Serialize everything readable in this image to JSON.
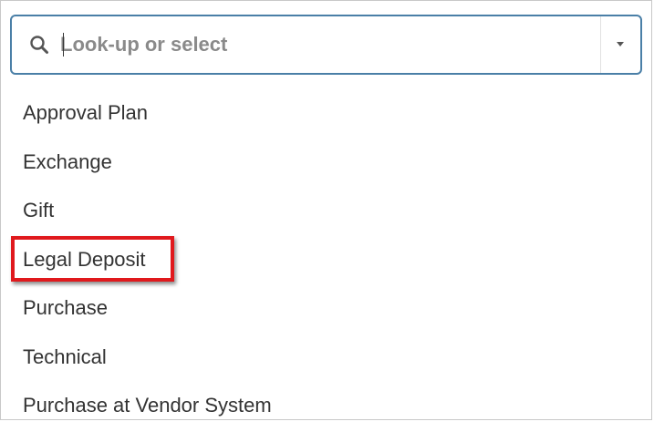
{
  "search": {
    "placeholder": "Look-up or select",
    "value": "",
    "icon": "search-icon",
    "toggle_icon": "chevron-down-icon",
    "border_color": "#4a7fa7"
  },
  "options": [
    {
      "label": "Approval Plan"
    },
    {
      "label": "Exchange"
    },
    {
      "label": "Gift"
    },
    {
      "label": "Legal Deposit"
    },
    {
      "label": "Purchase"
    },
    {
      "label": "Technical"
    },
    {
      "label": "Purchase at Vendor System"
    }
  ],
  "annotation": {
    "highlighted_option": "Legal Deposit",
    "color": "#e0191d"
  }
}
